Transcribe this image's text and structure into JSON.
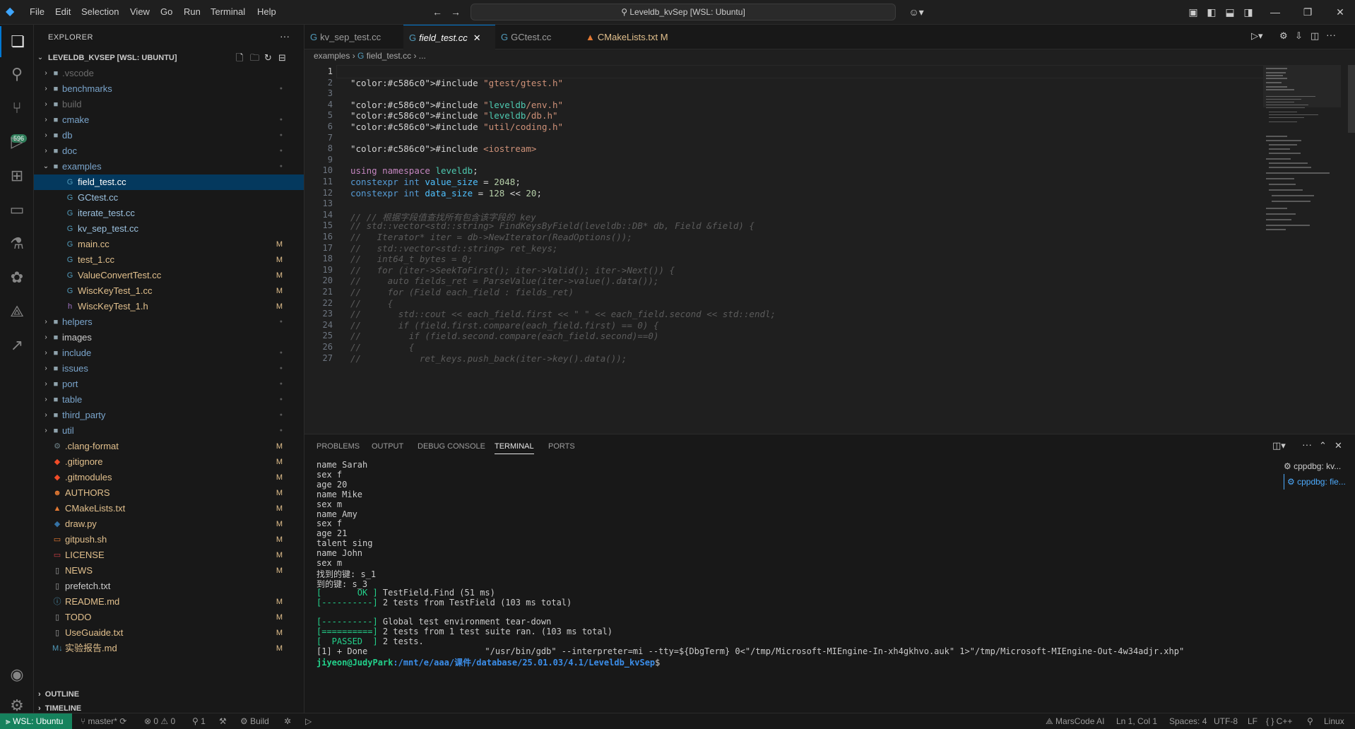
{
  "menu": [
    "File",
    "Edit",
    "Selection",
    "View",
    "Go",
    "Run",
    "Terminal",
    "Help"
  ],
  "command_center": "Leveldb_kvSep [WSL: Ubuntu]",
  "activity_badge": "596",
  "explorer": {
    "title": "EXPLORER",
    "root": "LEVELDB_KVSEP [WSL: UBUNTU]",
    "items": [
      {
        "name": ".vscode",
        "type": "folder",
        "color": "#6c7a89",
        "deco": ""
      },
      {
        "name": "benchmarks",
        "type": "folder",
        "color": "#cccccc",
        "deco": "●"
      },
      {
        "name": "build",
        "type": "folder",
        "color": "#6c7a89",
        "deco": ""
      },
      {
        "name": "cmake",
        "type": "folder",
        "color": "#cccccc",
        "deco": "●"
      },
      {
        "name": "db",
        "type": "folder",
        "color": "#cccccc",
        "deco": "●"
      },
      {
        "name": "doc",
        "type": "folder",
        "color": "#cccccc",
        "deco": "●"
      },
      {
        "name": "examples",
        "type": "folder-open",
        "color": "#cccccc",
        "deco": "●"
      },
      {
        "name": "field_test.cc",
        "type": "cpp",
        "color": "#cccccc",
        "deco": ""
      },
      {
        "name": "GCtest.cc",
        "type": "cpp",
        "color": "#cccccc",
        "deco": ""
      },
      {
        "name": "iterate_test.cc",
        "type": "cpp",
        "color": "#cccccc",
        "deco": ""
      },
      {
        "name": "kv_sep_test.cc",
        "type": "cpp",
        "color": "#cccccc",
        "deco": ""
      },
      {
        "name": "main.cc",
        "type": "cpp",
        "color": "#cccccc",
        "deco": "M"
      },
      {
        "name": "test_1.cc",
        "type": "cpp",
        "color": "#cccccc",
        "deco": "M"
      },
      {
        "name": "ValueConvertTest.cc",
        "type": "cpp",
        "color": "#cccccc",
        "deco": "M"
      },
      {
        "name": "WiscKeyTest_1.cc",
        "type": "cpp",
        "color": "#cccccc",
        "deco": "M"
      },
      {
        "name": "WiscKeyTest_1.h",
        "type": "h",
        "color": "#cccccc",
        "deco": "M"
      },
      {
        "name": "helpers",
        "type": "folder",
        "color": "#cccccc",
        "deco": "●"
      },
      {
        "name": "images",
        "type": "folder",
        "color": "#cccccc",
        "deco": ""
      },
      {
        "name": "include",
        "type": "folder",
        "color": "#cccccc",
        "deco": "●"
      },
      {
        "name": "issues",
        "type": "folder",
        "color": "#cccccc",
        "deco": "●"
      },
      {
        "name": "port",
        "type": "folder",
        "color": "#cccccc",
        "deco": "●"
      },
      {
        "name": "table",
        "type": "folder",
        "color": "#cccccc",
        "deco": "●"
      },
      {
        "name": "third_party",
        "type": "folder",
        "color": "#cccccc",
        "deco": "●"
      },
      {
        "name": "util",
        "type": "folder",
        "color": "#cccccc",
        "deco": "●"
      },
      {
        "name": ".clang-format",
        "type": "gear",
        "color": "#cccccc",
        "deco": "M"
      },
      {
        "name": ".gitignore",
        "type": "git",
        "color": "#cccccc",
        "deco": "M"
      },
      {
        "name": ".gitmodules",
        "type": "git",
        "color": "#cccccc",
        "deco": "M"
      },
      {
        "name": "AUTHORS",
        "type": "people",
        "color": "#cccccc",
        "deco": "M"
      },
      {
        "name": "CMakeLists.txt",
        "type": "cmake",
        "color": "#cccccc",
        "deco": "M"
      },
      {
        "name": "draw.py",
        "type": "py",
        "color": "#cccccc",
        "deco": "M"
      },
      {
        "name": "gitpush.sh",
        "type": "sh",
        "color": "#cccccc",
        "deco": "M"
      },
      {
        "name": "LICENSE",
        "type": "license",
        "color": "#cccccc",
        "deco": "M"
      },
      {
        "name": "NEWS",
        "type": "file",
        "color": "#cccccc",
        "deco": "M"
      },
      {
        "name": "prefetch.txt",
        "type": "file",
        "color": "#cccccc",
        "deco": ""
      },
      {
        "name": "README.md",
        "type": "info",
        "color": "#cccccc",
        "deco": "M"
      },
      {
        "name": "TODO",
        "type": "file",
        "color": "#cccccc",
        "deco": "M"
      },
      {
        "name": "UseGuaide.txt",
        "type": "file",
        "color": "#cccccc",
        "deco": "M"
      },
      {
        "name": "实验报告.md",
        "type": "md",
        "color": "#cccccc",
        "deco": "M"
      }
    ],
    "outline": "OUTLINE",
    "timeline": "TIMELINE"
  },
  "tabs": [
    {
      "label": "kv_sep_test.cc",
      "icon": "G"
    },
    {
      "label": "field_test.cc",
      "icon": "G"
    },
    {
      "label": "GCtest.cc",
      "icon": "G"
    },
    {
      "label": "CMakeLists.txt",
      "icon": "▲",
      "mod": "M"
    }
  ],
  "breadcrumb": [
    "examples",
    "field_test.cc",
    "..."
  ],
  "editor_lines": [
    {
      "n": "1",
      "t": ""
    },
    {
      "n": "2",
      "t": "#include \"gtest/gtest.h\""
    },
    {
      "n": "3",
      "t": ""
    },
    {
      "n": "4",
      "t": "#include \"leveldb/env.h\""
    },
    {
      "n": "5",
      "t": "#include \"leveldb/db.h\""
    },
    {
      "n": "6",
      "t": "#include \"util/coding.h\""
    },
    {
      "n": "7",
      "t": ""
    },
    {
      "n": "8",
      "t": "#include <iostream>"
    },
    {
      "n": "9",
      "t": ""
    },
    {
      "n": "10",
      "t": "using namespace leveldb;"
    },
    {
      "n": "11",
      "t": "constexpr int value_size = 2048;"
    },
    {
      "n": "12",
      "t": "constexpr int data_size = 128 << 20;"
    },
    {
      "n": "13",
      "t": ""
    },
    {
      "n": "14",
      "t": "// // 根据字段值查找所有包含该字段的 key"
    },
    {
      "n": "15",
      "t": "// std::vector<std::string> FindKeysByField(leveldb::DB* db, Field &field) {"
    },
    {
      "n": "16",
      "t": "//   Iterator* iter = db->NewIterator(ReadOptions());"
    },
    {
      "n": "17",
      "t": "//   std::vector<std::string> ret_keys;"
    },
    {
      "n": "18",
      "t": "//   int64_t bytes = 0;"
    },
    {
      "n": "19",
      "t": "//   for (iter->SeekToFirst(); iter->Valid(); iter->Next()) {"
    },
    {
      "n": "20",
      "t": "//     auto fields_ret = ParseValue(iter->value().data());"
    },
    {
      "n": "21",
      "t": "//     for (Field each_field : fields_ret)"
    },
    {
      "n": "22",
      "t": "//     {"
    },
    {
      "n": "23",
      "t": "//       std::cout << each_field.first << \" \" << each_field.second << std::endl;"
    },
    {
      "n": "24",
      "t": "//       if (field.first.compare(each_field.first) == 0) {"
    },
    {
      "n": "25",
      "t": "//         if (field.second.compare(each_field.second)==0)"
    },
    {
      "n": "26",
      "t": "//         {"
    },
    {
      "n": "27",
      "t": "//           ret_keys.push_back(iter->key().data());"
    }
  ],
  "panel_tabs": [
    "PROBLEMS",
    "OUTPUT",
    "DEBUG CONSOLE",
    "TERMINAL",
    "PORTS"
  ],
  "terminal_lines": [
    "name Sarah",
    "sex f",
    "age 20",
    "name Mike",
    "sex m",
    "name Amy",
    "sex f",
    "age 21",
    "talent sing",
    "name John",
    "sex m",
    "找到的键: s_1",
    "到的键: s_3",
    "[       OK ] TestField.Find (51 ms)",
    "[----------] 2 tests from TestField (103 ms total)",
    "",
    "[----------] Global test environment tear-down",
    "[==========] 2 tests from 1 test suite ran. (103 ms total)",
    "[  PASSED  ] 2 tests.",
    "[1] + Done                       \"/usr/bin/gdb\" --interpreter=mi --tty=${DbgTerm} 0<\"/tmp/Microsoft-MIEngine-In-xh4gkhvo.auk\" 1>\"/tmp/Microsoft-MIEngine-Out-4w34adjr.xhp\""
  ],
  "prompt": {
    "user": "jiyeon@JudyPark",
    "path": ":/mnt/e/aaa/课件/database/25.01.03/4.1/Leveldb_kvSep",
    "suffix": "$"
  },
  "terminal_list": [
    "cppdbg: kv...",
    "cppdbg: fie..."
  ],
  "status": {
    "remote": "WSL: Ubuntu",
    "branch": "master*",
    "problems": "⊗ 0 ⚠ 0",
    "ports": "⚲ 1",
    "build": "Build",
    "marscode": "MarsCode AI",
    "position": "Ln 1, Col 1",
    "spaces": "Spaces: 4",
    "encoding": "UTF-8",
    "eol": "LF",
    "language": "{ } C++",
    "platform": "Linux"
  }
}
